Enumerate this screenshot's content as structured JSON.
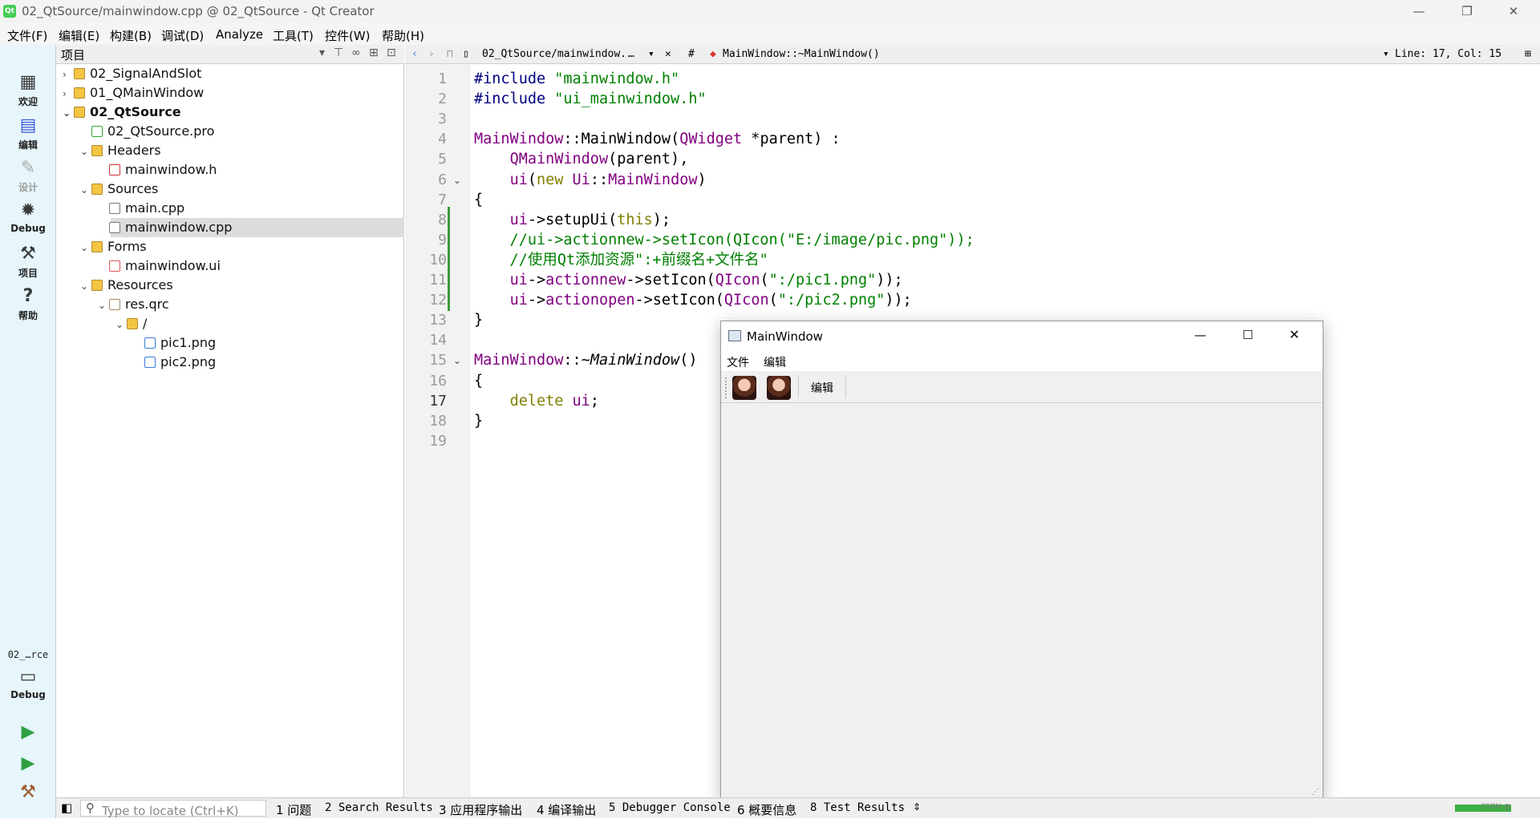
{
  "window": {
    "title": "02_QtSource/mainwindow.cpp @ 02_QtSource - Qt Creator",
    "app_icon_text": "Qt",
    "minimize": "—",
    "restore": "❐",
    "close": "✕"
  },
  "menu": [
    "文件(F)",
    "编辑(E)",
    "构建(B)",
    "调试(D)",
    "Analyze",
    "工具(T)",
    "控件(W)",
    "帮助(H)"
  ],
  "modes": [
    {
      "label": "欢迎",
      "icon": "grid-icon"
    },
    {
      "label": "编辑",
      "icon": "edit-icon"
    },
    {
      "label": "设计",
      "icon": "design-icon"
    },
    {
      "label": "Debug",
      "icon": "bug-icon"
    },
    {
      "label": "项目",
      "icon": "wrench-icon"
    },
    {
      "label": "帮助",
      "icon": "help-icon"
    }
  ],
  "kit": {
    "project": "02_…rce",
    "label": "Debug"
  },
  "project_pane": {
    "title": "项目",
    "tree": [
      {
        "label": "02_SignalAndSlot",
        "depth": 0,
        "arrow": "›",
        "icon": "folder"
      },
      {
        "label": "01_QMainWindow",
        "depth": 0,
        "arrow": "›",
        "icon": "folder"
      },
      {
        "label": "02_QtSource",
        "depth": 0,
        "arrow": "⌄",
        "icon": "folder",
        "bold": true
      },
      {
        "label": "02_QtSource.pro",
        "depth": 1,
        "arrow": "",
        "icon": "pro"
      },
      {
        "label": "Headers",
        "depth": 1,
        "arrow": "⌄",
        "icon": "folder"
      },
      {
        "label": "mainwindow.h",
        "depth": 2,
        "arrow": "",
        "icon": "h"
      },
      {
        "label": "Sources",
        "depth": 1,
        "arrow": "⌄",
        "icon": "folder"
      },
      {
        "label": "main.cpp",
        "depth": 2,
        "arrow": "",
        "icon": "file"
      },
      {
        "label": "mainwindow.cpp",
        "depth": 2,
        "arrow": "",
        "icon": "file",
        "selected": true
      },
      {
        "label": "Forms",
        "depth": 1,
        "arrow": "⌄",
        "icon": "folder"
      },
      {
        "label": "mainwindow.ui",
        "depth": 2,
        "arrow": "",
        "icon": "ui"
      },
      {
        "label": "Resources",
        "depth": 1,
        "arrow": "⌄",
        "icon": "folder"
      },
      {
        "label": "res.qrc",
        "depth": 2,
        "arrow": "⌄",
        "icon": "qrc"
      },
      {
        "label": "/",
        "depth": 3,
        "arrow": "⌄",
        "icon": "folder"
      },
      {
        "label": "pic1.png",
        "depth": 4,
        "arrow": "",
        "icon": "img"
      },
      {
        "label": "pic2.png",
        "depth": 4,
        "arrow": "",
        "icon": "img"
      }
    ]
  },
  "editor": {
    "file_tab": "02_QtSource/mainwindow.",
    "ellipsis": "…",
    "hash": "#",
    "symbol": "MainWindow::~MainWindow()",
    "cursor": "Line: 17, Col: 15",
    "current_line": 17,
    "lines": [
      [
        {
          "t": "#include ",
          "c": "pp"
        },
        {
          "t": "\"mainwindow.h\"",
          "c": "str"
        }
      ],
      [
        {
          "t": "#include ",
          "c": "pp"
        },
        {
          "t": "\"ui_mainwindow.h\"",
          "c": "str"
        }
      ],
      [],
      [
        {
          "t": "MainWindow",
          "c": "ty"
        },
        {
          "t": "::",
          "c": ""
        },
        {
          "t": "MainWindow",
          "c": ""
        },
        {
          "t": "(",
          "c": ""
        },
        {
          "t": "QWidget",
          "c": "ty"
        },
        {
          "t": " *parent) :",
          "c": ""
        }
      ],
      [
        {
          "t": "    ",
          "c": ""
        },
        {
          "t": "QMainWindow",
          "c": "ty"
        },
        {
          "t": "(parent),",
          "c": ""
        }
      ],
      [
        {
          "t": "    ",
          "c": ""
        },
        {
          "t": "ui",
          "c": "ty"
        },
        {
          "t": "(",
          "c": ""
        },
        {
          "t": "new",
          "c": "kw"
        },
        {
          "t": " ",
          "c": ""
        },
        {
          "t": "Ui",
          "c": "ty"
        },
        {
          "t": "::",
          "c": ""
        },
        {
          "t": "MainWindow",
          "c": "ty"
        },
        {
          "t": ")",
          "c": ""
        }
      ],
      [
        {
          "t": "{",
          "c": ""
        }
      ],
      [
        {
          "t": "    ",
          "c": ""
        },
        {
          "t": "ui",
          "c": "ty"
        },
        {
          "t": "->setupUi(",
          "c": ""
        },
        {
          "t": "this",
          "c": "kw"
        },
        {
          "t": ");",
          "c": ""
        }
      ],
      [
        {
          "t": "    //ui->actionnew->setIcon(QIcon(\"E:/image/pic.png\"));",
          "c": "cm"
        }
      ],
      [
        {
          "t": "    //使用Qt添加资源\":+前缀名+文件名\"",
          "c": "cm"
        }
      ],
      [
        {
          "t": "    ",
          "c": ""
        },
        {
          "t": "ui",
          "c": "ty"
        },
        {
          "t": "->",
          "c": ""
        },
        {
          "t": "actionnew",
          "c": "ty"
        },
        {
          "t": "->setIcon(",
          "c": ""
        },
        {
          "t": "QIcon",
          "c": "ty"
        },
        {
          "t": "(",
          "c": ""
        },
        {
          "t": "\":/pic1.png\"",
          "c": "str"
        },
        {
          "t": "));",
          "c": ""
        }
      ],
      [
        {
          "t": "    ",
          "c": ""
        },
        {
          "t": "ui",
          "c": "ty"
        },
        {
          "t": "->",
          "c": ""
        },
        {
          "t": "actionopen",
          "c": "ty"
        },
        {
          "t": "->setIcon(",
          "c": ""
        },
        {
          "t": "QIcon",
          "c": "ty"
        },
        {
          "t": "(",
          "c": ""
        },
        {
          "t": "\":/pic2.png\"",
          "c": "str"
        },
        {
          "t": "));",
          "c": ""
        }
      ],
      [
        {
          "t": "}",
          "c": ""
        }
      ],
      [],
      [
        {
          "t": "MainWindow",
          "c": "ty"
        },
        {
          "t": "::~",
          "c": ""
        },
        {
          "t": "MainWindow",
          "c": "ital"
        },
        {
          "t": "()",
          "c": ""
        }
      ],
      [
        {
          "t": "{",
          "c": ""
        }
      ],
      [
        {
          "t": "    ",
          "c": ""
        },
        {
          "t": "delete",
          "c": "kw"
        },
        {
          "t": " ",
          "c": ""
        },
        {
          "t": "ui",
          "c": "ty"
        },
        {
          "t": ";",
          "c": ""
        }
      ],
      [
        {
          "t": "}",
          "c": ""
        }
      ],
      []
    ],
    "fold_lines": [
      6,
      15
    ]
  },
  "app_window": {
    "title": "MainWindow",
    "menu": [
      "文件",
      "编辑"
    ],
    "toolbar_text": "编辑"
  },
  "status": {
    "locate_placeholder": "Type to locate (Ctrl+K)",
    "panes": [
      "1 问题",
      "2 Search Results",
      "3 应用程序输出",
      "4 编译输出",
      "5 Debugger Console",
      "6 概要信息",
      "8 Test Results"
    ],
    "watermark": "CSDN @"
  }
}
